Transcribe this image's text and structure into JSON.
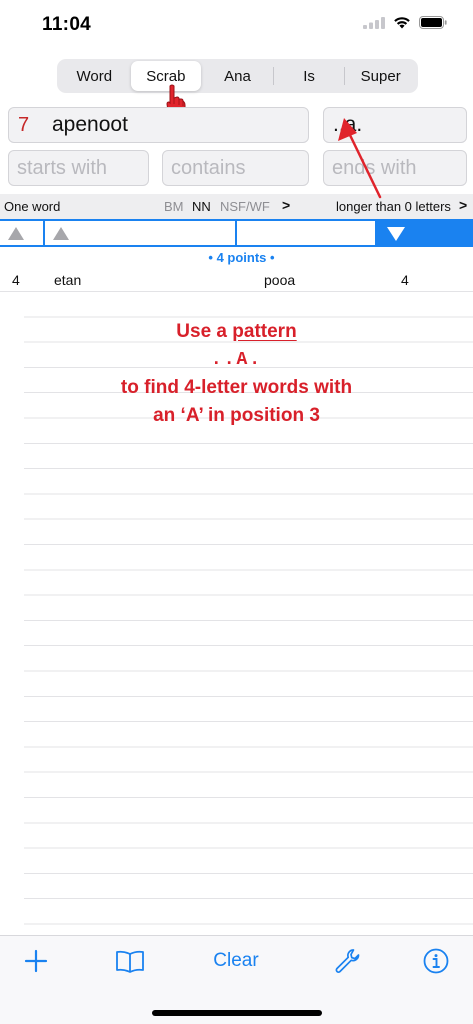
{
  "status": {
    "time": "11:04"
  },
  "segments": [
    {
      "label": "Word",
      "active": false
    },
    {
      "label": "Scrab",
      "active": true
    },
    {
      "label": "Ana",
      "active": false
    },
    {
      "label": "Is",
      "active": false
    },
    {
      "label": "Super",
      "active": false
    }
  ],
  "inputs": {
    "letter_count": "7",
    "letters": "apenoot",
    "pattern": "..a.",
    "starts_placeholder": "starts with",
    "contains_placeholder": "contains",
    "ends_placeholder": "ends with"
  },
  "options": {
    "one_word": "One word",
    "bm": "BM",
    "nn": "NN",
    "nsf": "NSF/WF",
    "chevron": ">",
    "longer": "longer than 0 letters",
    "chevron2": ">"
  },
  "results": {
    "group_header": "• 4 points •",
    "rows": [
      {
        "c1": "4",
        "c2": "etan",
        "c3": "pooa",
        "c4": "4"
      }
    ]
  },
  "annotation": {
    "line1_prefix": "Use a ",
    "line1_link": "pattern",
    "line2": "..A.",
    "line3": "to find 4-letter words with",
    "line4": "an ‘A’ in position 3"
  },
  "toolbar": {
    "add_icon": "plus-icon",
    "book_icon": "book-icon",
    "clear_label": "Clear",
    "wrench_icon": "wrench-icon",
    "info_icon": "info-icon"
  },
  "colors": {
    "accent": "#1a82f0",
    "annotation_red": "#d8202a",
    "count_red": "#c62828"
  }
}
